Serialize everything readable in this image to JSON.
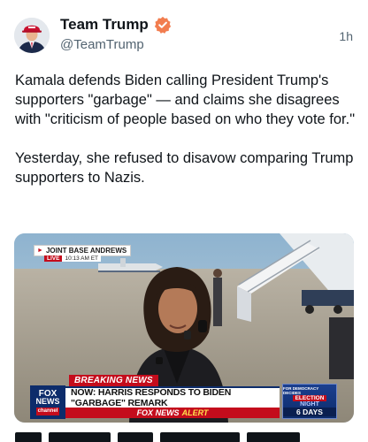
{
  "post": {
    "author": {
      "display_name": "Team Trump",
      "handle": "@TeamTrump",
      "verified_badge": "verified-badge-icon",
      "verified_color": "#f27d4f"
    },
    "timestamp": "1h",
    "text": "Kamala defends Biden calling President Trump's supporters \"garbage\" — and claims she disagrees with \"criticism of people based on who they vote for.\"\n\nYesterday, she refused to disavow comparing Trump supporters to Nazis.",
    "media": {
      "type": "video-still",
      "location_tag": "JOINT BASE ANDREWS",
      "live_label": "LIVE",
      "live_time": "10:13 AM ET",
      "breaking_label": "BREAKING NEWS",
      "headline": "NOW: HARRIS RESPONDS TO BIDEN \"GARBAGE\" REMARK",
      "alert_brand": "FOX NEWS",
      "alert_word": "ALERT",
      "network_logo_lines": [
        "FOX",
        "NEWS",
        "channel"
      ],
      "election_top": "FOR DEMOCRACY DECIDES",
      "election_title": "ELECTION",
      "election_sub": "NIGHT",
      "election_countdown": "6 DAYS"
    }
  },
  "colors": {
    "text_primary": "#0f1419",
    "text_secondary": "#536471",
    "fox_blue": "#0d2c6b",
    "fox_red": "#c40c1c"
  }
}
